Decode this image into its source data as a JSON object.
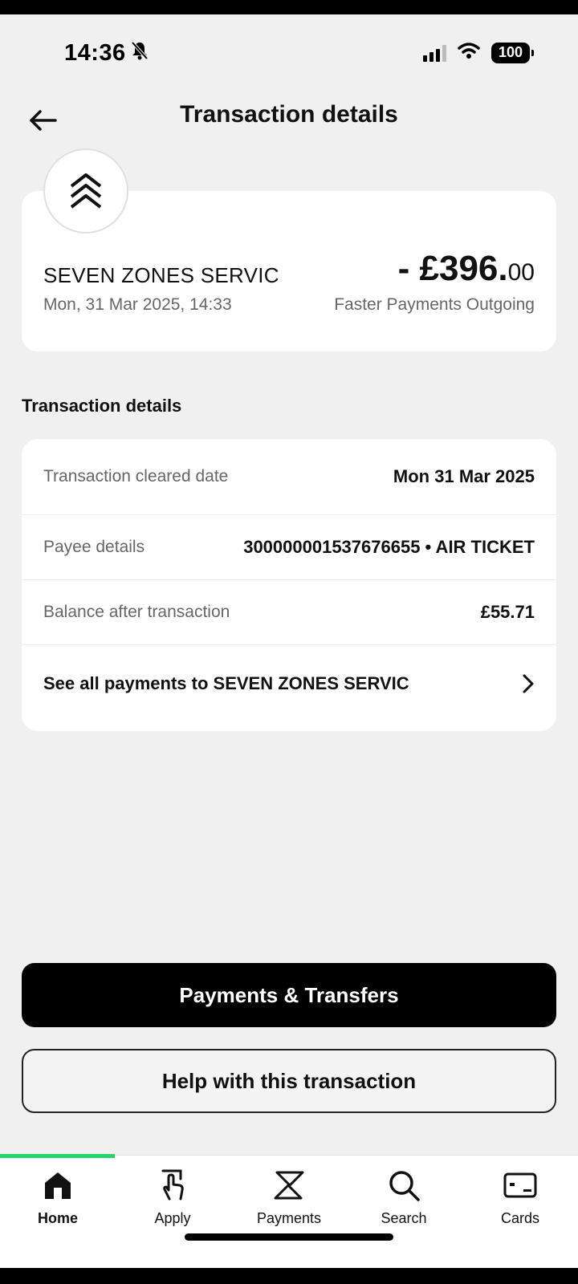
{
  "status_bar": {
    "time": "14:36",
    "battery": "100"
  },
  "header": {
    "title": "Transaction details"
  },
  "summary": {
    "merchant": "SEVEN ZONES SERVIC",
    "datetime": "Mon, 31 Mar 2025, 14:33",
    "amount_main": "- £396.",
    "amount_pence": "00",
    "type": "Faster Payments Outgoing"
  },
  "details": {
    "section_title": "Transaction details",
    "rows": [
      {
        "label": "Transaction cleared date",
        "value": "Mon 31 Mar 2025"
      },
      {
        "label": "Payee details",
        "value": "300000001537676655 • AIR TICKET"
      },
      {
        "label": "Balance after transaction",
        "value": "£55.71"
      }
    ],
    "see_all_label": "See all payments to SEVEN ZONES SERVIC"
  },
  "actions": {
    "primary_label": "Payments & Transfers",
    "secondary_label": "Help with this transaction"
  },
  "nav": {
    "items": [
      {
        "label": "Home",
        "icon": "home-icon"
      },
      {
        "label": "Apply",
        "icon": "apply-hand-icon"
      },
      {
        "label": "Payments",
        "icon": "payments-arrows-icon"
      },
      {
        "label": "Search",
        "icon": "search-icon"
      },
      {
        "label": "Cards",
        "icon": "card-icon"
      }
    ],
    "active": "Home",
    "accent": "#22d46a"
  }
}
